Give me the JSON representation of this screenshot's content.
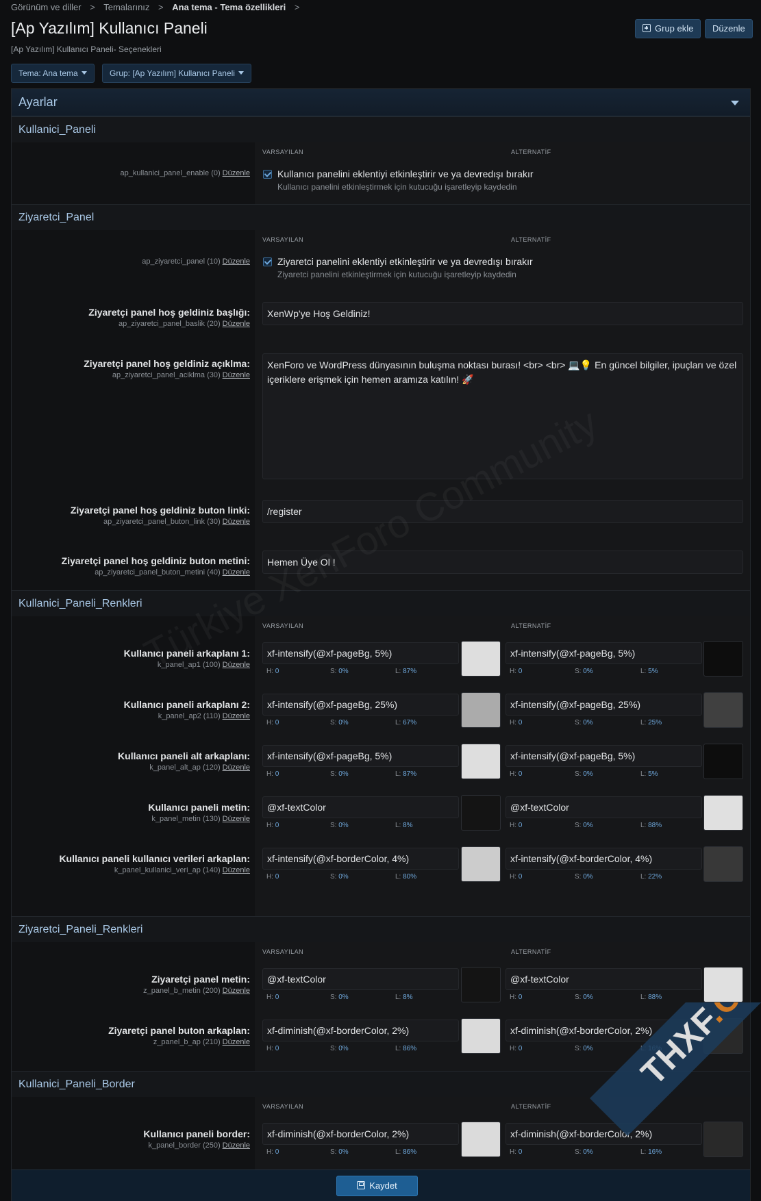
{
  "breadcrumb": {
    "items": [
      "Görünüm ve diller",
      "Temalarınız",
      "Ana tema - Tema özellikleri"
    ],
    "separator": ">"
  },
  "page": {
    "title": "[Ap Yazılım] Kullanıcı Paneli",
    "subtitle": "[Ap Yazılım] Kullanıcı Paneli- Seçenekleri"
  },
  "header_actions": {
    "add_group": "Grup ekle",
    "edit": "Düzenle"
  },
  "filters": {
    "theme": "Tema: Ana tema",
    "group": "Grup: [Ap Yazılım] Kullanıcı Paneli"
  },
  "panel": {
    "title": "Ayarlar"
  },
  "column_labels": {
    "default": "VARSAYILAN",
    "alternative": "ALTERNATİF"
  },
  "edit_link": "Düzenle",
  "hsl_labels": {
    "h": "H:",
    "s": "S:",
    "l": "L:"
  },
  "sections": {
    "kullanici_paneli": {
      "title": "Kullanici_Paneli",
      "enable": {
        "meta": "ap_kullanici_panel_enable (0)",
        "checked": true,
        "label": "Kullanıcı panelini eklentiyi etkinleştirir ve ya devredışı bırakır",
        "hint": "Kullanıcı panelini etkinleştirmek için kutucuğu işaretleyip kaydedin"
      }
    },
    "ziyaretci_panel": {
      "title": "Ziyaretci_Panel",
      "enable": {
        "meta": "ap_ziyaretci_panel (10)",
        "checked": true,
        "label": "Ziyaretci panelini eklentiyi etkinleştirir ve ya devredışı bırakır",
        "hint": "Ziyaretci panelini etkinleştirmek için kutucuğu işaretleyip kaydedin"
      },
      "baslik": {
        "label": "Ziyaretçi panel hoş geldiniz başlığı:",
        "meta": "ap_ziyaretci_panel_baslik (20)",
        "value": "XenWp'ye Hoş Geldiniz!"
      },
      "aciklama": {
        "label": "Ziyaretçi panel hoş geldiniz açıklma:",
        "meta": "ap_ziyaretci_panel_aciklma (30)",
        "value": "XenForo ve WordPress dünyasının buluşma noktası burası! <br> <br> 💻💡 En güncel bilgiler, ipuçları ve özel içeriklere erişmek için hemen aramıza katılın! 🚀"
      },
      "buton_link": {
        "label": "Ziyaretçi panel hoş geldiniz buton linki:",
        "meta": "ap_ziyaretci_panel_buton_link (30)",
        "value": "/register"
      },
      "buton_metni": {
        "label": "Ziyaretçi panel hoş geldiniz buton metini:",
        "meta": "ap_ziyaretci_panel_buton_metini (40)",
        "value": "Hemen Üye Ol !"
      }
    },
    "kullanici_paneli_renkleri": {
      "title": "Kullanici_Paneli_Renkleri",
      "rows": [
        {
          "label": "Kullanıcı paneli arkaplanı 1:",
          "meta": "k_panel_ap1 (100)",
          "default": {
            "value": "xf-intensify(@xf-pageBg, 5%)",
            "h": "0",
            "s": "0%",
            "l": "87%",
            "swatch": "#dedede"
          },
          "alt": {
            "value": "xf-intensify(@xf-pageBg, 5%)",
            "h": "0",
            "s": "0%",
            "l": "5%",
            "swatch": "#0d0d0d"
          }
        },
        {
          "label": "Kullanıcı paneli arkaplanı 2:",
          "meta": "k_panel_ap2 (110)",
          "default": {
            "value": "xf-intensify(@xf-pageBg, 25%)",
            "h": "0",
            "s": "0%",
            "l": "67%",
            "swatch": "#ababab"
          },
          "alt": {
            "value": "xf-intensify(@xf-pageBg, 25%)",
            "h": "0",
            "s": "0%",
            "l": "25%",
            "swatch": "#404040"
          }
        },
        {
          "label": "Kullanıcı paneli alt arkaplanı:",
          "meta": "k_panel_alt_ap (120)",
          "default": {
            "value": "xf-intensify(@xf-pageBg, 5%)",
            "h": "0",
            "s": "0%",
            "l": "87%",
            "swatch": "#dedede"
          },
          "alt": {
            "value": "xf-intensify(@xf-pageBg, 5%)",
            "h": "0",
            "s": "0%",
            "l": "5%",
            "swatch": "#0d0d0d"
          }
        },
        {
          "label": "Kullanıcı paneli metin:",
          "meta": "k_panel_metin (130)",
          "default": {
            "value": "@xf-textColor",
            "h": "0",
            "s": "0%",
            "l": "8%",
            "swatch": "#141414"
          },
          "alt": {
            "value": "@xf-textColor",
            "h": "0",
            "s": "0%",
            "l": "88%",
            "swatch": "#e0e0e0"
          }
        },
        {
          "label": "Kullanıcı paneli kullanıcı verileri arkaplan:",
          "meta": "k_panel_kullanici_veri_ap (140)",
          "default": {
            "value": "xf-intensify(@xf-borderColor, 4%)",
            "h": "0",
            "s": "0%",
            "l": "80%",
            "swatch": "#cccccc"
          },
          "alt": {
            "value": "xf-intensify(@xf-borderColor, 4%)",
            "h": "0",
            "s": "0%",
            "l": "22%",
            "swatch": "#383838"
          }
        }
      ]
    },
    "ziyaretci_paneli_renkleri": {
      "title": "Ziyaretci_Paneli_Renkleri",
      "rows": [
        {
          "label": "Ziyaretçi panel metin:",
          "meta": "z_panel_b_metin (200)",
          "default": {
            "value": "@xf-textColor",
            "h": "0",
            "s": "0%",
            "l": "8%",
            "swatch": "#141414"
          },
          "alt": {
            "value": "@xf-textColor",
            "h": "0",
            "s": "0%",
            "l": "88%",
            "swatch": "#e0e0e0"
          }
        },
        {
          "label": "Ziyaretçi panel buton arkaplan:",
          "meta": "z_panel_b_ap (210)",
          "default": {
            "value": "xf-diminish(@xf-borderColor, 2%)",
            "h": "0",
            "s": "0%",
            "l": "86%",
            "swatch": "#dbdbdb"
          },
          "alt": {
            "value": "xf-diminish(@xf-borderColor, 2%)",
            "h": "0",
            "s": "0%",
            "l": "16%",
            "swatch": "#292929"
          }
        }
      ]
    },
    "kullanici_paneli_border": {
      "title": "Kullanici_Paneli_Border",
      "rows": [
        {
          "label": "Kullanıcı paneli border:",
          "meta": "k_panel_border (250)",
          "default": {
            "value": "xf-diminish(@xf-borderColor, 2%)",
            "h": "0",
            "s": "0%",
            "l": "86%",
            "swatch": "#dbdbdb"
          },
          "alt": {
            "value": "xf-diminish(@xf-borderColor, 2%)",
            "h": "0",
            "s": "0%",
            "l": "16%",
            "swatch": "#292929"
          }
        }
      ]
    }
  },
  "footer": {
    "save": "Kaydet"
  },
  "watermarks": {
    "diagonal": "Türkiye XenForo Community",
    "corner_thxf": "THXF",
    "corner_org": ".ORG"
  }
}
